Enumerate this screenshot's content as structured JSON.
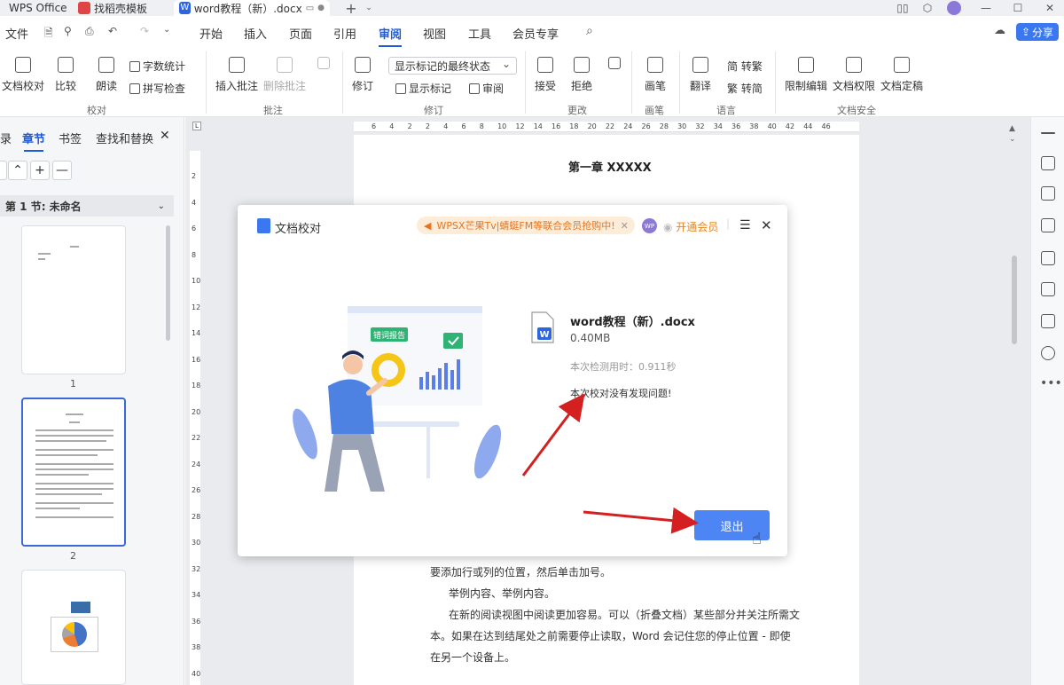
{
  "tabs": [
    {
      "label": "WPS Office"
    },
    {
      "label": "找稻壳模板"
    },
    {
      "label": "word教程（新）.docx"
    }
  ],
  "menu": {
    "file": "文件",
    "items": [
      "开始",
      "插入",
      "页面",
      "引用",
      "审阅",
      "视图",
      "工具",
      "会员专享"
    ],
    "active": "审阅",
    "share": "分享"
  },
  "ribbon": {
    "proofing": {
      "doc_check": "文档校对",
      "compare": "比较",
      "read": "朗读",
      "word_count": "字数统计",
      "spell_check": "拼写检查",
      "group": "校对"
    },
    "comments": {
      "insert": "插入批注",
      "delete": "删除批注",
      "group": "批注"
    },
    "revision": {
      "track": "修订",
      "display_mode": "显示标记的最终状态",
      "show_marks": "显示标记",
      "review": "审阅",
      "group": "修订"
    },
    "changes": {
      "accept": "接受",
      "reject": "拒绝",
      "group": "更改"
    },
    "pen": {
      "pen": "画笔",
      "group": "画笔"
    },
    "language": {
      "translate": "翻译",
      "to_trad": "简 转繁",
      "to_simp": "繁 转简",
      "group": "语言"
    },
    "security": {
      "restrict": "限制编辑",
      "rights": "文档权限",
      "finalize": "文档定稿",
      "group": "文档安全"
    }
  },
  "leftpanel": {
    "tabs": [
      "录",
      "章节",
      "书签",
      "查找和替换"
    ],
    "active_tab": "章节",
    "section_label": "第 1 节: 未命名",
    "page_numbers": [
      "1",
      "2"
    ]
  },
  "ruler": {
    "h_ticks": [
      "6",
      "4",
      "2",
      "2",
      "4",
      "6",
      "8",
      "10",
      "12",
      "14",
      "16",
      "18",
      "20",
      "22",
      "24",
      "26",
      "28",
      "30",
      "32",
      "34",
      "36",
      "38",
      "40",
      "42",
      "44",
      "46"
    ],
    "v_ticks": [
      "2",
      "4",
      "6",
      "8",
      "10",
      "12",
      "14",
      "16",
      "18",
      "20",
      "22",
      "24",
      "26",
      "28",
      "30",
      "32",
      "34",
      "36",
      "38",
      "40"
    ]
  },
  "document": {
    "heading": "第一章 XXXXX",
    "lines": [
      "要添加行或列的位置，然后单击加号。",
      "举例内容、举例内容。",
      "在新的阅读视图中阅读更加容易。可以（折叠文档）某些部分并关注所需文",
      "本。如果在达到结尾处之前需要停止读取，Word 会记住您的停止位置 - 即使",
      "在另一个设备上。"
    ]
  },
  "dialog": {
    "title": "文档校对",
    "promo": "WPSX芒果Tv|蜻蜓FM等联合会员抢购中!",
    "avatar": "WP",
    "vip": "开通会员",
    "illustration_label": "错词报告",
    "file_name": "word教程（新）.docx",
    "file_size": "0.40MB",
    "timing": "本次检测用时：0.911秒",
    "result": "本次校对没有发现问题!",
    "exit": "退出"
  },
  "colors": {
    "accent": "#1f5bd8",
    "exit_button": "#4e85f4",
    "promo_text": "#e8731c",
    "arrow": "#d42020"
  }
}
